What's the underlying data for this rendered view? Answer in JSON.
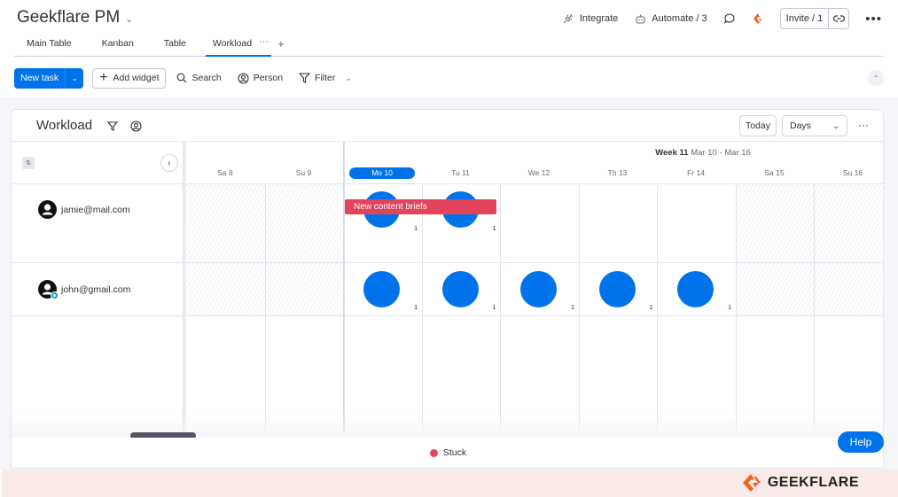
{
  "header": {
    "board_title": "Geekflare PM",
    "actions": {
      "integrate": "Integrate",
      "automate": "Automate / 3",
      "invite": "Invite / 1"
    }
  },
  "tabs": [
    {
      "label": "Main Table",
      "active": false
    },
    {
      "label": "Kanban",
      "active": false
    },
    {
      "label": "Table",
      "active": false
    },
    {
      "label": "Workload",
      "active": true
    }
  ],
  "toolbar": {
    "new_task": "New task",
    "add_widget": "Add widget",
    "search": "Search",
    "person": "Person",
    "filter": "Filter"
  },
  "widget": {
    "title": "Workload",
    "today_label": "Today",
    "view_select": "Days",
    "week_bold": "Week 11",
    "week_range": "Mar 10 - Mar 16",
    "days": [
      {
        "label": "Sa 8",
        "weekend": true,
        "today": false
      },
      {
        "label": "Su 9",
        "weekend": true,
        "today": false
      },
      {
        "label": "Mo 10",
        "weekend": false,
        "today": true
      },
      {
        "label": "Tu 11",
        "weekend": false,
        "today": false
      },
      {
        "label": "We 12",
        "weekend": false,
        "today": false
      },
      {
        "label": "Th 13",
        "weekend": false,
        "today": false
      },
      {
        "label": "Fr 14",
        "weekend": false,
        "today": false
      },
      {
        "label": "Sa 15",
        "weekend": true,
        "today": false
      },
      {
        "label": "Su 16",
        "weekend": true,
        "today": false
      }
    ],
    "people": [
      {
        "email": "jamie@mail.com",
        "workload": [
          null,
          null,
          1,
          1,
          null,
          null,
          null,
          null,
          null
        ],
        "task": {
          "label": "New content briefs",
          "status": "Stuck"
        }
      },
      {
        "email": "john@gmail.com",
        "workload": [
          null,
          null,
          1,
          1,
          1,
          1,
          1,
          null,
          null
        ]
      }
    ],
    "legend": [
      {
        "label": "Stuck",
        "color": "#e2445c"
      }
    ]
  },
  "colors": {
    "primary": "#0073ea",
    "stuck": "#e2445c",
    "brand": "#f26122"
  },
  "help_label": "Help",
  "brand_name": "GEEKFLARE"
}
